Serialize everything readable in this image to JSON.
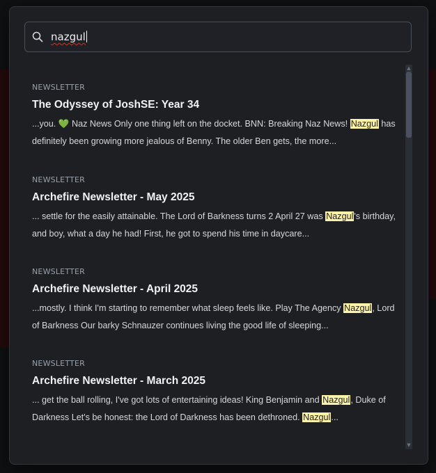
{
  "search": {
    "value": "nazgul",
    "icon": "search-icon"
  },
  "results": [
    {
      "type": "NEWSLETTER",
      "title": "The Odyssey of JoshSE: Year 34",
      "snippet_before": "...you. ",
      "emoji": "💚",
      "snippet_mid": " Naz News Only one thing left on the docket. BNN: Breaking Naz News! ",
      "highlight_1": "Nazgul",
      "snippet_after": " has definitely been growing more jealous of Benny. The older Ben gets, the more..."
    },
    {
      "type": "NEWSLETTER",
      "title": "Archefire Newsletter - May 2025",
      "snippet_before": "... settle for the easily attainable. The Lord of Barkness turns 2 April 27 was ",
      "highlight_1": "Nazgul",
      "snippet_after": "'s birthday, and boy, what a day he had! First, he got to spend his time in daycare..."
    },
    {
      "type": "NEWSLETTER",
      "title": "Archefire Newsletter - April 2025",
      "snippet_before": "...mostly. I think I'm starting to remember what sleep feels like. Play The Agency ",
      "highlight_1": "Nazgul",
      "snippet_after": ", Lord of Barkness Our barky Schnauzer continues living the good life of sleeping..."
    },
    {
      "type": "NEWSLETTER",
      "title": "Archefire Newsletter - March 2025",
      "snippet_before": "... get the ball rolling, I've got lots of entertaining ideas! King Benjamin and ",
      "highlight_1": "Nazgul",
      "snippet_mid": ", Duke of Darkness Let's be honest: the Lord of Darkness has been dethroned. ",
      "highlight_2": "Nazgul",
      "snippet_after": "..."
    }
  ],
  "colors": {
    "highlight": "#fdf3a8",
    "modal_bg": "#1d1f23",
    "heart": "#3fae6a"
  }
}
